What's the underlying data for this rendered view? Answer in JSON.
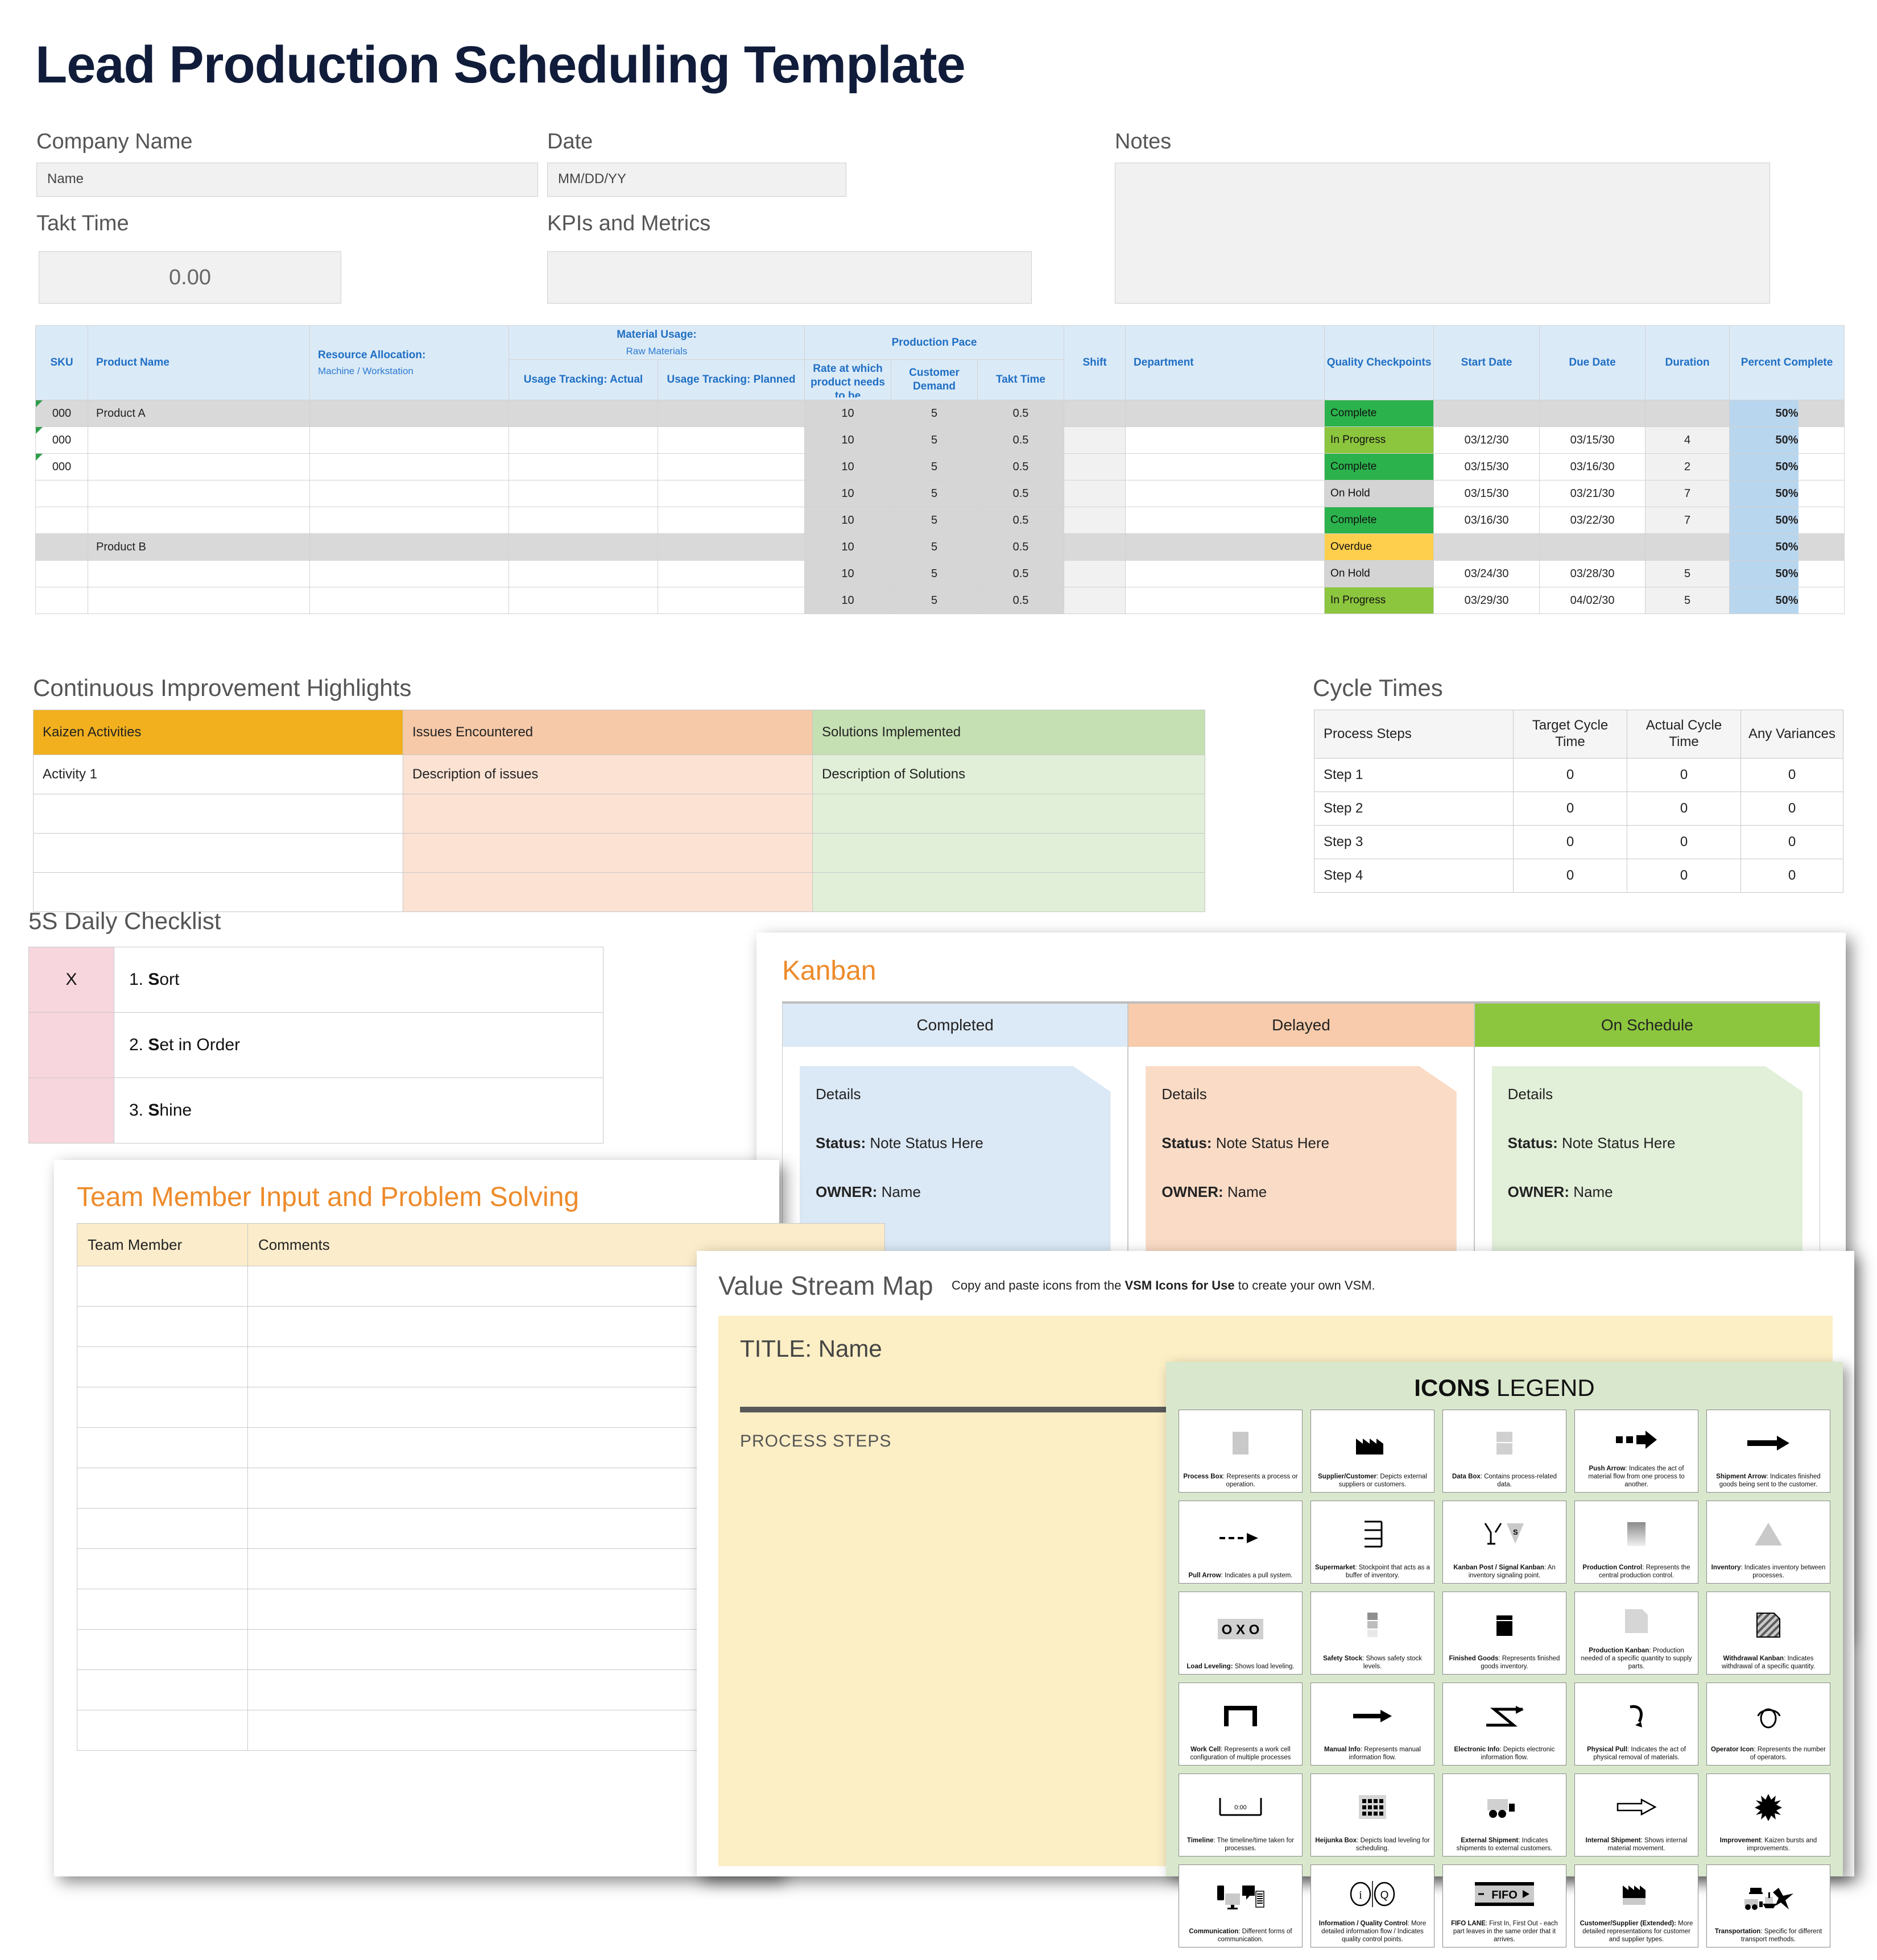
{
  "title": "Lead Production Scheduling Template",
  "fields": {
    "company_label": "Company Name",
    "company_value": "Name",
    "date_label": "Date",
    "date_value": "MM/DD/YY",
    "takt_label": "Takt Time",
    "takt_value": "0.00",
    "kpi_label": "KPIs and Metrics",
    "kpi_value": "",
    "notes_label": "Notes",
    "notes_value": ""
  },
  "schedule": {
    "headers": {
      "sku": "SKU",
      "product_name": "Product Name",
      "resource_allocation": "Resource Allocation:",
      "resource_allocation_sub": "Machine / Workstation",
      "material_usage": "Material Usage:",
      "material_usage_sub": "Raw Materials",
      "usage_actual": "Usage Tracking: Actual",
      "usage_planned": "Usage Tracking: Planned",
      "production_pace": "Production Pace",
      "rate": "Rate at which product needs to be completed",
      "customer_demand": "Customer Demand",
      "takt_time": "Takt Time",
      "shift": "Shift",
      "department": "Department",
      "quality_checkpoints": "Quality Checkpoints",
      "start_date": "Start Date",
      "due_date": "Due Date",
      "duration": "Duration",
      "percent_complete": "Percent Complete"
    },
    "rows": [
      {
        "sku": "000",
        "product": "Product A",
        "resource": "",
        "actual": "",
        "planned": "",
        "rate": "10",
        "demand": "5",
        "takt": "0.5",
        "shift": "",
        "department": "",
        "status": "Complete",
        "status_kind": "complete",
        "start": "",
        "due": "",
        "duration": "",
        "percent": "50%",
        "band": "grey",
        "flag": true
      },
      {
        "sku": "000",
        "product": "",
        "resource": "",
        "actual": "",
        "planned": "",
        "rate": "10",
        "demand": "5",
        "takt": "0.5",
        "shift": "",
        "department": "",
        "status": "In Progress",
        "status_kind": "progress",
        "start": "03/12/30",
        "due": "03/15/30",
        "duration": "4",
        "percent": "50%",
        "band": "white",
        "flag": true
      },
      {
        "sku": "000",
        "product": "",
        "resource": "",
        "actual": "",
        "planned": "",
        "rate": "10",
        "demand": "5",
        "takt": "0.5",
        "shift": "",
        "department": "",
        "status": "Complete",
        "status_kind": "complete",
        "start": "03/15/30",
        "due": "03/16/30",
        "duration": "2",
        "percent": "50%",
        "band": "white",
        "flag": true
      },
      {
        "sku": "",
        "product": "",
        "resource": "",
        "actual": "",
        "planned": "",
        "rate": "10",
        "demand": "5",
        "takt": "0.5",
        "shift": "",
        "department": "",
        "status": "On Hold",
        "status_kind": "hold",
        "start": "03/15/30",
        "due": "03/21/30",
        "duration": "7",
        "percent": "50%",
        "band": "white",
        "flag": false
      },
      {
        "sku": "",
        "product": "",
        "resource": "",
        "actual": "",
        "planned": "",
        "rate": "10",
        "demand": "5",
        "takt": "0.5",
        "shift": "",
        "department": "",
        "status": "Complete",
        "status_kind": "complete",
        "start": "03/16/30",
        "due": "03/22/30",
        "duration": "7",
        "percent": "50%",
        "band": "white",
        "flag": false
      },
      {
        "sku": "",
        "product": "Product B",
        "resource": "",
        "actual": "",
        "planned": "",
        "rate": "10",
        "demand": "5",
        "takt": "0.5",
        "shift": "",
        "department": "",
        "status": "Overdue",
        "status_kind": "overdue",
        "start": "",
        "due": "",
        "duration": "",
        "percent": "50%",
        "band": "grey",
        "flag": false
      },
      {
        "sku": "",
        "product": "",
        "resource": "",
        "actual": "",
        "planned": "",
        "rate": "10",
        "demand": "5",
        "takt": "0.5",
        "shift": "",
        "department": "",
        "status": "On Hold",
        "status_kind": "hold",
        "start": "03/24/30",
        "due": "03/28/30",
        "duration": "5",
        "percent": "50%",
        "band": "white",
        "flag": false
      },
      {
        "sku": "",
        "product": "",
        "resource": "",
        "actual": "",
        "planned": "",
        "rate": "10",
        "demand": "5",
        "takt": "0.5",
        "shift": "",
        "department": "",
        "status": "In Progress",
        "status_kind": "progress",
        "start": "03/29/30",
        "due": "04/02/30",
        "duration": "5",
        "percent": "50%",
        "band": "white",
        "flag": false
      }
    ]
  },
  "continuous_improvement": {
    "heading": "Continuous Improvement Highlights",
    "headers": [
      "Kaizen Activities",
      "Issues Encountered",
      "Solutions Implemented"
    ],
    "rows": [
      [
        "Activity 1",
        "Description of issues",
        "Description of Solutions"
      ],
      [
        "",
        "",
        ""
      ],
      [
        "",
        "",
        ""
      ],
      [
        "",
        "",
        ""
      ]
    ]
  },
  "cycle_times": {
    "heading": "Cycle Times",
    "headers": [
      "Process Steps",
      "Target Cycle Time",
      "Actual Cycle Time",
      "Any Variances"
    ],
    "rows": [
      [
        "Step 1",
        "0",
        "0",
        "0"
      ],
      [
        "Step 2",
        "0",
        "0",
        "0"
      ],
      [
        "Step 3",
        "0",
        "0",
        "0"
      ],
      [
        "Step 4",
        "0",
        "0",
        "0"
      ]
    ]
  },
  "five_s": {
    "heading": "5S Daily Checklist",
    "rows": [
      {
        "mark": "X",
        "label": "1. Sort",
        "bold": "S",
        "rest": "ort",
        "num": "1. "
      },
      {
        "mark": "",
        "label": "2. Set in Order",
        "bold": "S",
        "rest": "et in Order",
        "num": "2. "
      },
      {
        "mark": "",
        "label": "3. Shine",
        "bold": "S",
        "rest": "hine",
        "num": "3. "
      }
    ]
  },
  "kanban": {
    "heading": "Kanban",
    "columns": [
      {
        "title": "Completed",
        "kind": "c",
        "details": "Details",
        "status_label": "Status:",
        "status_value": "Note Status Here",
        "owner_label": "OWNER:",
        "owner_value": "Name"
      },
      {
        "title": "Delayed",
        "kind": "d",
        "details": "Details",
        "status_label": "Status:",
        "status_value": "Note Status Here",
        "owner_label": "OWNER:",
        "owner_value": "Name"
      },
      {
        "title": "On Schedule",
        "kind": "s",
        "details": "Details",
        "status_label": "Status:",
        "status_value": "Note Status Here",
        "owner_label": "OWNER:",
        "owner_value": "Name"
      }
    ]
  },
  "team": {
    "heading": "Team Member Input and Problem Solving",
    "headers": [
      "Team Member",
      "Comments"
    ],
    "row_count": 12
  },
  "vsm": {
    "heading": "Value Stream Map",
    "subtitle_pre": "Copy and paste icons from the ",
    "subtitle_bold": "VSM Icons for Use",
    "subtitle_post": " to create your own VSM.",
    "title_line": "TITLE: Name",
    "process_steps": "PROCESS STEPS"
  },
  "legend": {
    "title_bold": "ICONS",
    "title_rest": " LEGEND",
    "items": [
      {
        "icon": "process-box-icon",
        "name": "Process Box",
        "desc": ": Represents a process or operation."
      },
      {
        "icon": "supplier-customer-factory-icon",
        "name": "Supplier/Customer",
        "desc": ": Depicts external suppliers or customers."
      },
      {
        "icon": "data-box-icon",
        "name": "Data Box",
        "desc": ": Contains process-related data."
      },
      {
        "icon": "push-arrow-icon",
        "name": "Push Arrow",
        "desc": ": Indicates the act of material flow from one process to another."
      },
      {
        "icon": "shipment-arrow-icon",
        "name": "Shipment Arrow",
        "desc": ": Indicates finished goods being sent to the customer."
      },
      {
        "icon": "pull-arrow-icon",
        "name": "Pull Arrow",
        "desc": ": Indicates a pull system."
      },
      {
        "icon": "supermarket-icon",
        "name": "Supermarket",
        "desc": ": Stockpoint that acts as a buffer of inventory."
      },
      {
        "icon": "kanban-post-signal-icon",
        "name": "Kanban Post / Signal Kanban",
        "desc": ": An inventory signaling point."
      },
      {
        "icon": "production-control-icon",
        "name": "Production Control",
        "desc": ": Represents the central production control."
      },
      {
        "icon": "inventory-triangle-icon",
        "name": "Inventory",
        "desc": ": Indicates inventory between processes."
      },
      {
        "icon": "load-leveling-icon",
        "name": "Load Leveling:",
        "desc": " Shows load leveling."
      },
      {
        "icon": "safety-stock-icon",
        "name": "Safety Stock",
        "desc": ": Shows safety stock levels."
      },
      {
        "icon": "finished-goods-icon",
        "name": "Finished Goods",
        "desc": ": Represents finished goods inventory."
      },
      {
        "icon": "production-kanban-icon",
        "name": "Production Kanban",
        "desc": ": Production needed of a specific quantity to supply parts."
      },
      {
        "icon": "withdrawal-kanban-icon",
        "name": "Withdrawal Kanban",
        "desc": ": Indicates withdrawal of a specific quantity."
      },
      {
        "icon": "work-cell-icon",
        "name": "Work Cell",
        "desc": ": Represents a work cell configuration of multiple processes"
      },
      {
        "icon": "manual-info-arrow-icon",
        "name": "Manual Info",
        "desc": ": Represents manual information flow."
      },
      {
        "icon": "electronic-info-icon",
        "name": "Electronic Info",
        "desc": ": Depicts electronic information flow."
      },
      {
        "icon": "physical-pull-icon",
        "name": "Physical Pull",
        "desc": ": Indicates the act of physical removal of materials."
      },
      {
        "icon": "operator-icon",
        "name": "Operator Icon",
        "desc": ": Represents the number of operators."
      },
      {
        "icon": "timeline-icon",
        "name": "Timeline",
        "desc": ": The timeline/time taken for processes."
      },
      {
        "icon": "heijunka-box-icon",
        "name": "Heijunka Box",
        "desc": ": Depicts load leveling for scheduling."
      },
      {
        "icon": "external-shipment-truck-icon",
        "name": "External Shipment",
        "desc": ": Indicates shipments to external customers."
      },
      {
        "icon": "internal-shipment-arrow-icon",
        "name": "Internal Shipment",
        "desc": ": Shows internal material movement."
      },
      {
        "icon": "improvement-burst-icon",
        "name": "Improvement",
        "desc": ": Kaizen bursts and improvements."
      },
      {
        "icon": "communication-icon",
        "name": "Communication",
        "desc": ": Different forms of communication."
      },
      {
        "icon": "information-quality-icon",
        "name": "Information / Quality Control",
        "desc": ": More detailed information flow / Indicates quality control points."
      },
      {
        "icon": "fifo-lane-icon",
        "name": "FIFO LANE",
        "desc": ": First In, First Out - each part leaves in the same order that it arrives."
      },
      {
        "icon": "customer-supplier-extended-icon",
        "name": "Customer/Supplier (Extended):",
        "desc": " More detailed representations for customer and supplier types."
      },
      {
        "icon": "transportation-icon",
        "name": "Transportation",
        "desc": ": Specific for different transport methods."
      }
    ],
    "timeline_value": "0:00",
    "load_leveling_text": "O X O",
    "fifo_text": "FIFO",
    "info_glyph": "i",
    "quality_glyph": "Q",
    "signal_glyph": "S"
  },
  "colors": {
    "title": "#101c3a",
    "table_header_bg": "#dbeaf7",
    "table_header_text": "#1f6fc4",
    "status_complete": "#2bb24c",
    "status_in_progress": "#8cc63e",
    "status_on_hold": "#d4d4d4",
    "status_overdue": "#fdcf4d",
    "percent_bar": "#b9d6ef",
    "kaizen": "#f2b01e",
    "issues": "#f6c9a8",
    "solutions": "#c5e0b3",
    "accent_orange": "#ed8b2b",
    "vsm_body": "#fceec5",
    "legend_bg": "#d9e8cd"
  }
}
